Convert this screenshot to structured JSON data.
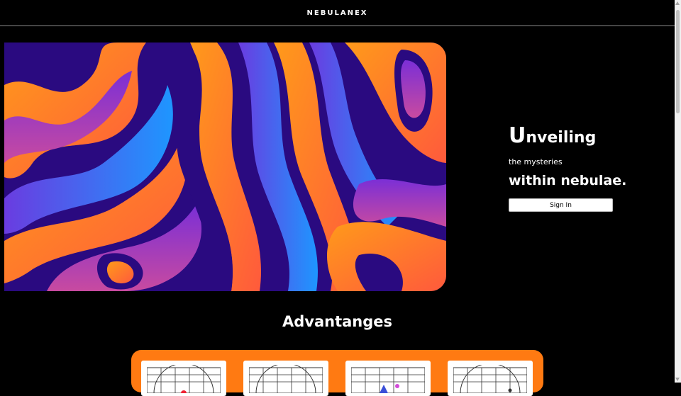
{
  "header": {
    "brand": "NEBULANEX"
  },
  "hero": {
    "line1_cap": "U",
    "line1_rest": "nveiling",
    "line2": "the mysteries",
    "line3": "within nebulae.",
    "signin_label": "Sign In"
  },
  "advantages": {
    "title": "Advantanges",
    "cards": [
      {
        "icon": "globe-grid-icon"
      },
      {
        "icon": "globe-grid-icon"
      },
      {
        "icon": "rocket-grid-icon"
      },
      {
        "icon": "globe-grid-icon"
      }
    ]
  },
  "colors": {
    "background": "#000000",
    "accent_orange": "#ff7a12",
    "purple": "#3a0f8f",
    "blue": "#1e90ff"
  }
}
